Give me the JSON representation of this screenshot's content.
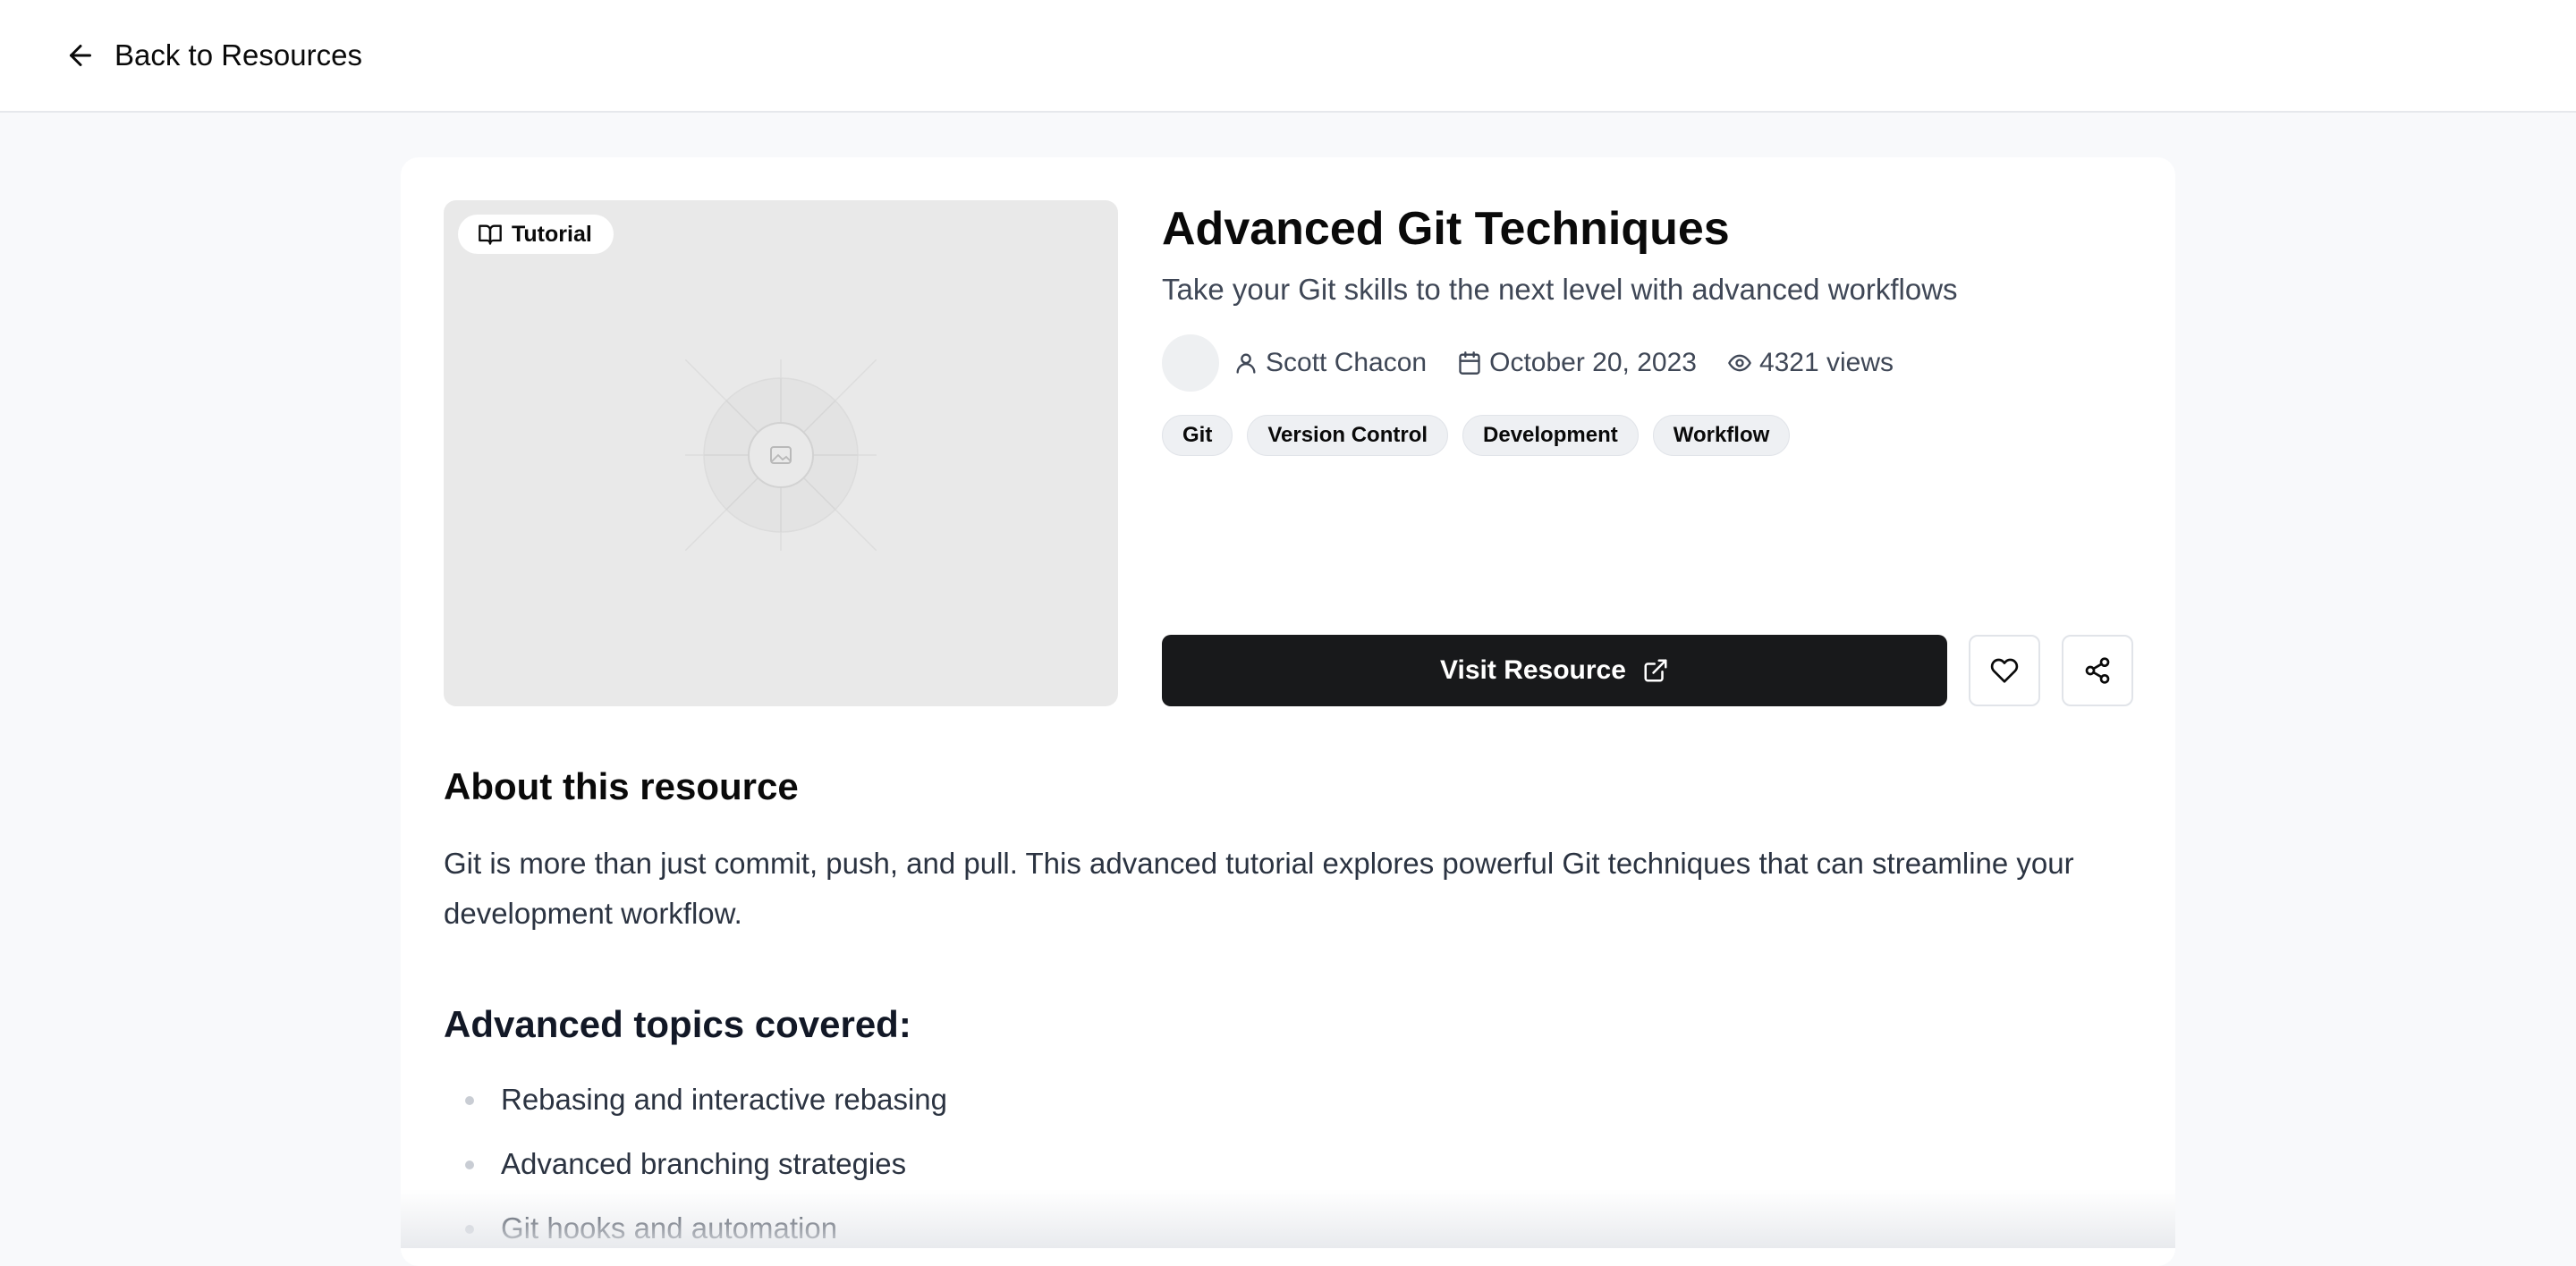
{
  "nav": {
    "back_label": "Back to Resources"
  },
  "resource": {
    "type_badge": "Tutorial",
    "title": "Advanced Git Techniques",
    "subtitle": "Take your Git skills to the next level with advanced workflows",
    "author": "Scott Chacon",
    "date": "October 20, 2023",
    "views": "4321 views",
    "tags": [
      "Git",
      "Version Control",
      "Development",
      "Workflow"
    ]
  },
  "actions": {
    "visit_label": "Visit Resource"
  },
  "about": {
    "heading": "About this resource",
    "text": "Git is more than just commit, push, and pull. This advanced tutorial explores powerful Git techniques that can streamline your development workflow.",
    "topics_heading": "Advanced topics covered:",
    "topics": [
      "Rebasing and interactive rebasing",
      "Advanced branching strategies",
      "Git hooks and automation"
    ]
  },
  "icons": {
    "back": "arrow-left-icon",
    "badge": "book-open-icon",
    "author": "user-icon",
    "date": "calendar-icon",
    "views": "eye-icon",
    "visit": "external-link-icon",
    "favorite": "heart-icon",
    "share": "share-icon"
  },
  "colors": {
    "primary_button": "#18191b",
    "page_bg": "#f8f9fb",
    "tag_bg": "#eef0f3"
  }
}
